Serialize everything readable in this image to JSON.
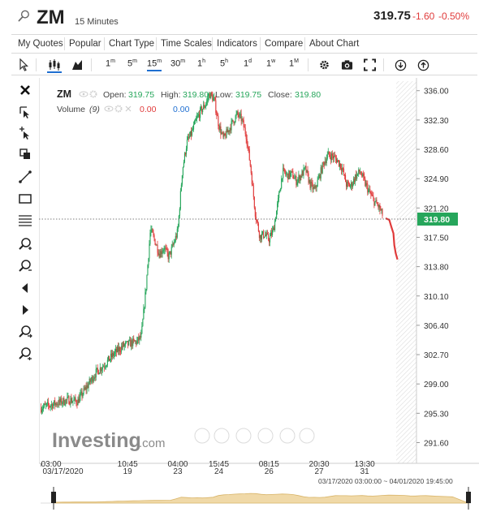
{
  "header": {
    "symbol": "ZM",
    "interval": "15 Minutes",
    "price": "319.75",
    "change": "-1.60",
    "change_pct": "-0.50%"
  },
  "menu": [
    "My Quotes",
    "Popular",
    "Chart Type",
    "Time Scales",
    "Indicators",
    "Compare",
    "About Chart"
  ],
  "toolbar": {
    "timeframes": [
      {
        "num": "1",
        "unit": "m"
      },
      {
        "num": "5",
        "unit": "m"
      },
      {
        "num": "15",
        "unit": "m"
      },
      {
        "num": "30",
        "unit": "m"
      },
      {
        "num": "1",
        "unit": "h"
      },
      {
        "num": "5",
        "unit": "h"
      },
      {
        "num": "1",
        "unit": "d"
      },
      {
        "num": "1",
        "unit": "w"
      },
      {
        "num": "1",
        "unit": "M"
      }
    ],
    "selected_timeframe": "15m"
  },
  "legend": {
    "symbol": "ZM",
    "open_label": "Open:",
    "open": "319.75",
    "high_label": "High:",
    "high": "319.80",
    "low_label": "Low:",
    "low": "319.75",
    "close_label": "Close:",
    "close": "319.80",
    "volume_label": "Volume",
    "volume_param": "(9)",
    "volume_val1": "0.00",
    "volume_val2": "0.00"
  },
  "price_tag": "319.80",
  "date_range": "03/17/2020 03:00:00 ~ 04/01/2020 19:45:00",
  "watermark": "Investing",
  "watermark_suffix": ".com",
  "colors": {
    "up": "#26a65b",
    "down": "#e03b3b",
    "accent": "#1f6fd1"
  },
  "chart_data": {
    "type": "candlestick",
    "y_ticks": [
      "336.00",
      "332.30",
      "328.60",
      "324.90",
      "321.20",
      "317.50",
      "313.80",
      "310.10",
      "306.40",
      "302.70",
      "299.00",
      "295.30",
      "291.60"
    ],
    "x_ticks": [
      {
        "time": "03:00",
        "date": "03/17/2020"
      },
      {
        "time": "10:45",
        "date": "19"
      },
      {
        "time": "04:00",
        "date": "23"
      },
      {
        "time": "15:45",
        "date": "24"
      },
      {
        "time": "08:15",
        "date": "26"
      },
      {
        "time": "20:30",
        "date": "27"
      },
      {
        "time": "13:30",
        "date": "31"
      }
    ],
    "ylim": [
      289.5,
      337.2
    ],
    "last_price": 319.8,
    "trend": [
      [
        0,
        296.0
      ],
      [
        3,
        296.5
      ],
      [
        6,
        297.0
      ],
      [
        8,
        296.8
      ],
      [
        10,
        298.6
      ],
      [
        12,
        300.4
      ],
      [
        14,
        301.5
      ],
      [
        16,
        302.8
      ],
      [
        18,
        303.8
      ],
      [
        20,
        304.2
      ],
      [
        21,
        304.3
      ],
      [
        22,
        305.0
      ],
      [
        23,
        311.0
      ],
      [
        24,
        318.5
      ],
      [
        25,
        317.0
      ],
      [
        26,
        315.4
      ],
      [
        27,
        316.2
      ],
      [
        28,
        315.0
      ],
      [
        29,
        316.5
      ],
      [
        30,
        318.3
      ],
      [
        31,
        326.0
      ],
      [
        32,
        329.5
      ],
      [
        33,
        330.6
      ],
      [
        34,
        332.2
      ],
      [
        35,
        333.4
      ],
      [
        36,
        334.2
      ],
      [
        37,
        335.6
      ],
      [
        38,
        334.8
      ],
      [
        39,
        331.6
      ],
      [
        40,
        329.9
      ],
      [
        41,
        330.9
      ],
      [
        42,
        332.0
      ],
      [
        43,
        333.0
      ],
      [
        44,
        332.4
      ],
      [
        45,
        330.4
      ],
      [
        46,
        326.2
      ],
      [
        47,
        320.5
      ],
      [
        48,
        317.6
      ],
      [
        49,
        317.9
      ],
      [
        50,
        317.2
      ],
      [
        51,
        318.5
      ],
      [
        52,
        322.0
      ],
      [
        53,
        325.8
      ],
      [
        54,
        325.3
      ],
      [
        55,
        325.5
      ],
      [
        56,
        324.6
      ],
      [
        57,
        325.3
      ],
      [
        58,
        326.1
      ],
      [
        59,
        324.2
      ],
      [
        60,
        323.4
      ],
      [
        61,
        325.1
      ],
      [
        62,
        326.9
      ],
      [
        63,
        327.9
      ],
      [
        64,
        327.7
      ],
      [
        65,
        327.2
      ],
      [
        66,
        326.3
      ],
      [
        67,
        324.1
      ],
      [
        68,
        324.0
      ],
      [
        69,
        325.2
      ],
      [
        70,
        325.8
      ],
      [
        71,
        324.4
      ],
      [
        72,
        323.2
      ],
      [
        73,
        322.1
      ],
      [
        74,
        321.4
      ],
      [
        75,
        320.2
      ]
    ],
    "extended": [
      [
        75.6,
        319.9
      ],
      [
        76.4,
        319.7
      ],
      [
        76.8,
        318.9
      ],
      [
        77.3,
        318.0
      ],
      [
        77.5,
        316.5
      ],
      [
        77.8,
        315.5
      ],
      [
        78.2,
        314.7
      ]
    ]
  }
}
